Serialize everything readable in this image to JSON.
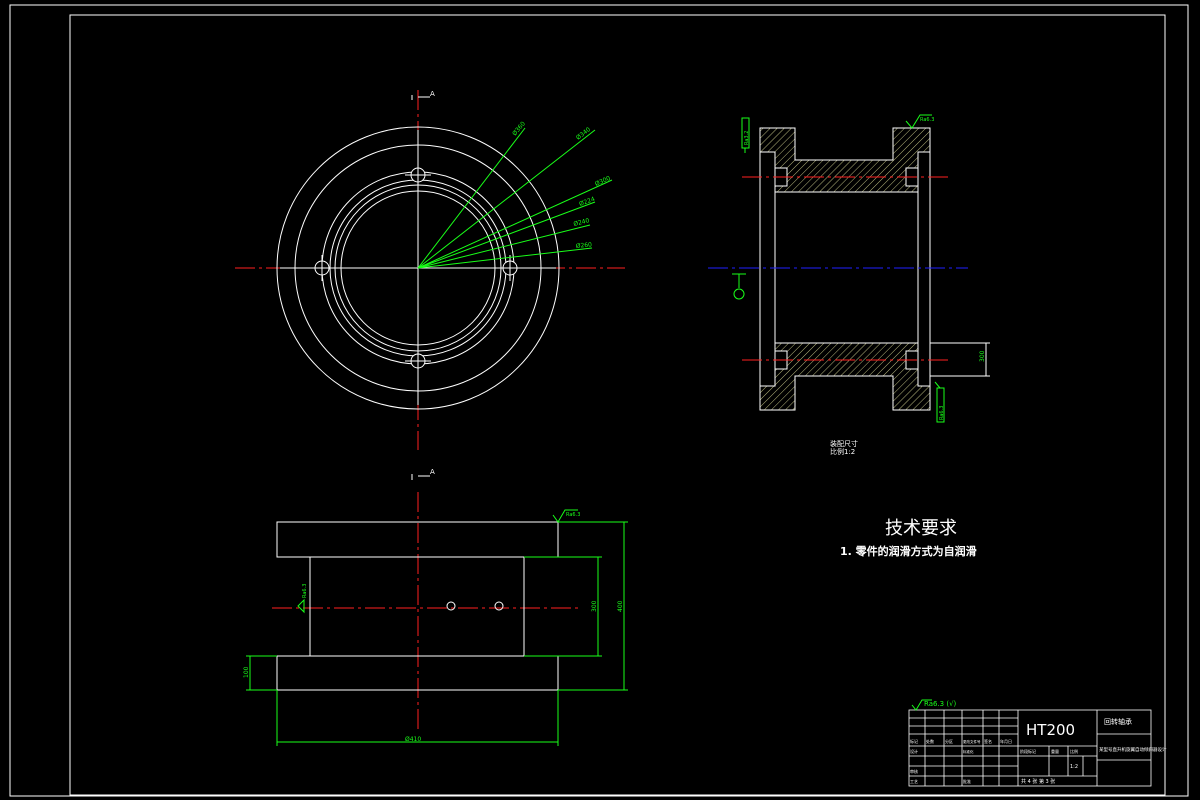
{
  "drawing": {
    "section_marker_top": "A",
    "section_marker_bottom": "A",
    "front_dimensions": [
      "Ø360",
      "Ø340",
      "Ø300",
      "Ø224",
      "Ø240",
      "Ø260"
    ],
    "side_roughness_top": "Ra6.3",
    "side_roughness_left": "Ra3.2",
    "side_roughness_bottom": "Ra6.3",
    "side_dim_right": "300",
    "side_view_note_line1": "装配尺寸",
    "side_view_note_line2": "比例1:2",
    "bottom_roughness": "Ra6.3",
    "bottom_roughness_left": "Ra6.3",
    "bottom_dim_height_inner": "300",
    "bottom_dim_height_outer": "400",
    "bottom_dim_flange": "100",
    "bottom_dim_width": "Ø410"
  },
  "tech_requirements": {
    "title": "技术要求",
    "item1": "1. 零件的润滑方式为自润滑"
  },
  "title_block": {
    "material": "HT200",
    "part_name": "回转轴承",
    "project": "某型号直升机旋翼自动倾斜器设计",
    "scale": "1:2",
    "sheet": "共 4 张  第 3 张",
    "roughness_note": "Ra6.3 (√)",
    "labels": {
      "mark": "标记",
      "count": "处数",
      "zone": "分区",
      "change_doc": "更改文件号",
      "sign": "签名",
      "date": "年月日",
      "design": "设计",
      "standardization": "标准化",
      "stage_mark": "阶段标记",
      "weight": "重量",
      "ratio": "比例",
      "check": "审核",
      "process": "工艺",
      "approve": "批准"
    }
  }
}
